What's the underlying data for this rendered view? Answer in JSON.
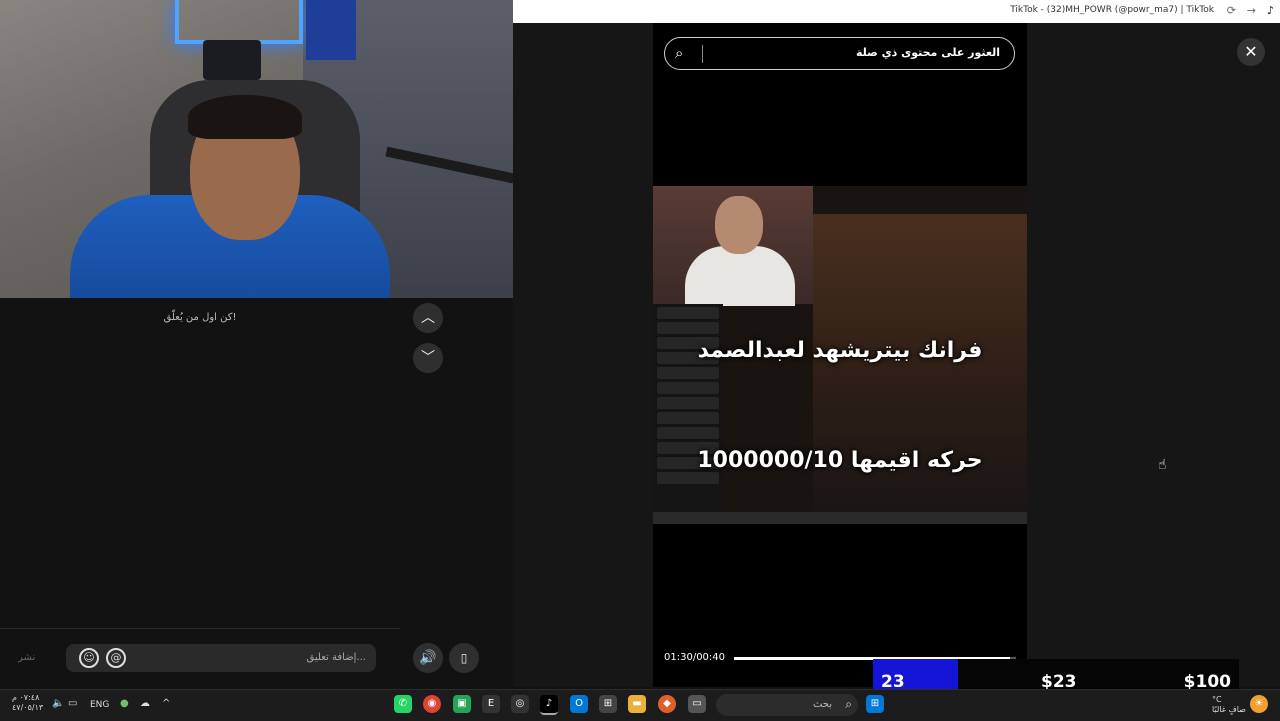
{
  "browser": {
    "title": "TikTok - (32)MH_POWR (@powr_ma7) | TikTok"
  },
  "comments": {
    "first_comment_prompt": "كن اول من يُعلّق!",
    "input_placeholder": "إضافة تعليق...",
    "post_label": "نشر"
  },
  "search": {
    "text": "العثور على محتوى ذي صلة"
  },
  "video": {
    "overlay_line1": "فرانك بيتريشهد لعبدالصمد",
    "overlay_line2": "حركه اقيمها 1000000/10",
    "time": "01:30/00:40",
    "progress": 0.98
  },
  "price_overlay": {
    "a": "23",
    "b": "$23",
    "c": "$100"
  },
  "taskbar": {
    "time": "٠٧:٤٨ م",
    "date": "٤٧/٠٥/١٣",
    "language": "ENG",
    "search_placeholder": "بحث",
    "weather_line1": "°C",
    "weather_line2": "صافٍ غالبًا"
  },
  "colors": {
    "accent_blue": "#1515d8",
    "background": "#121212"
  }
}
